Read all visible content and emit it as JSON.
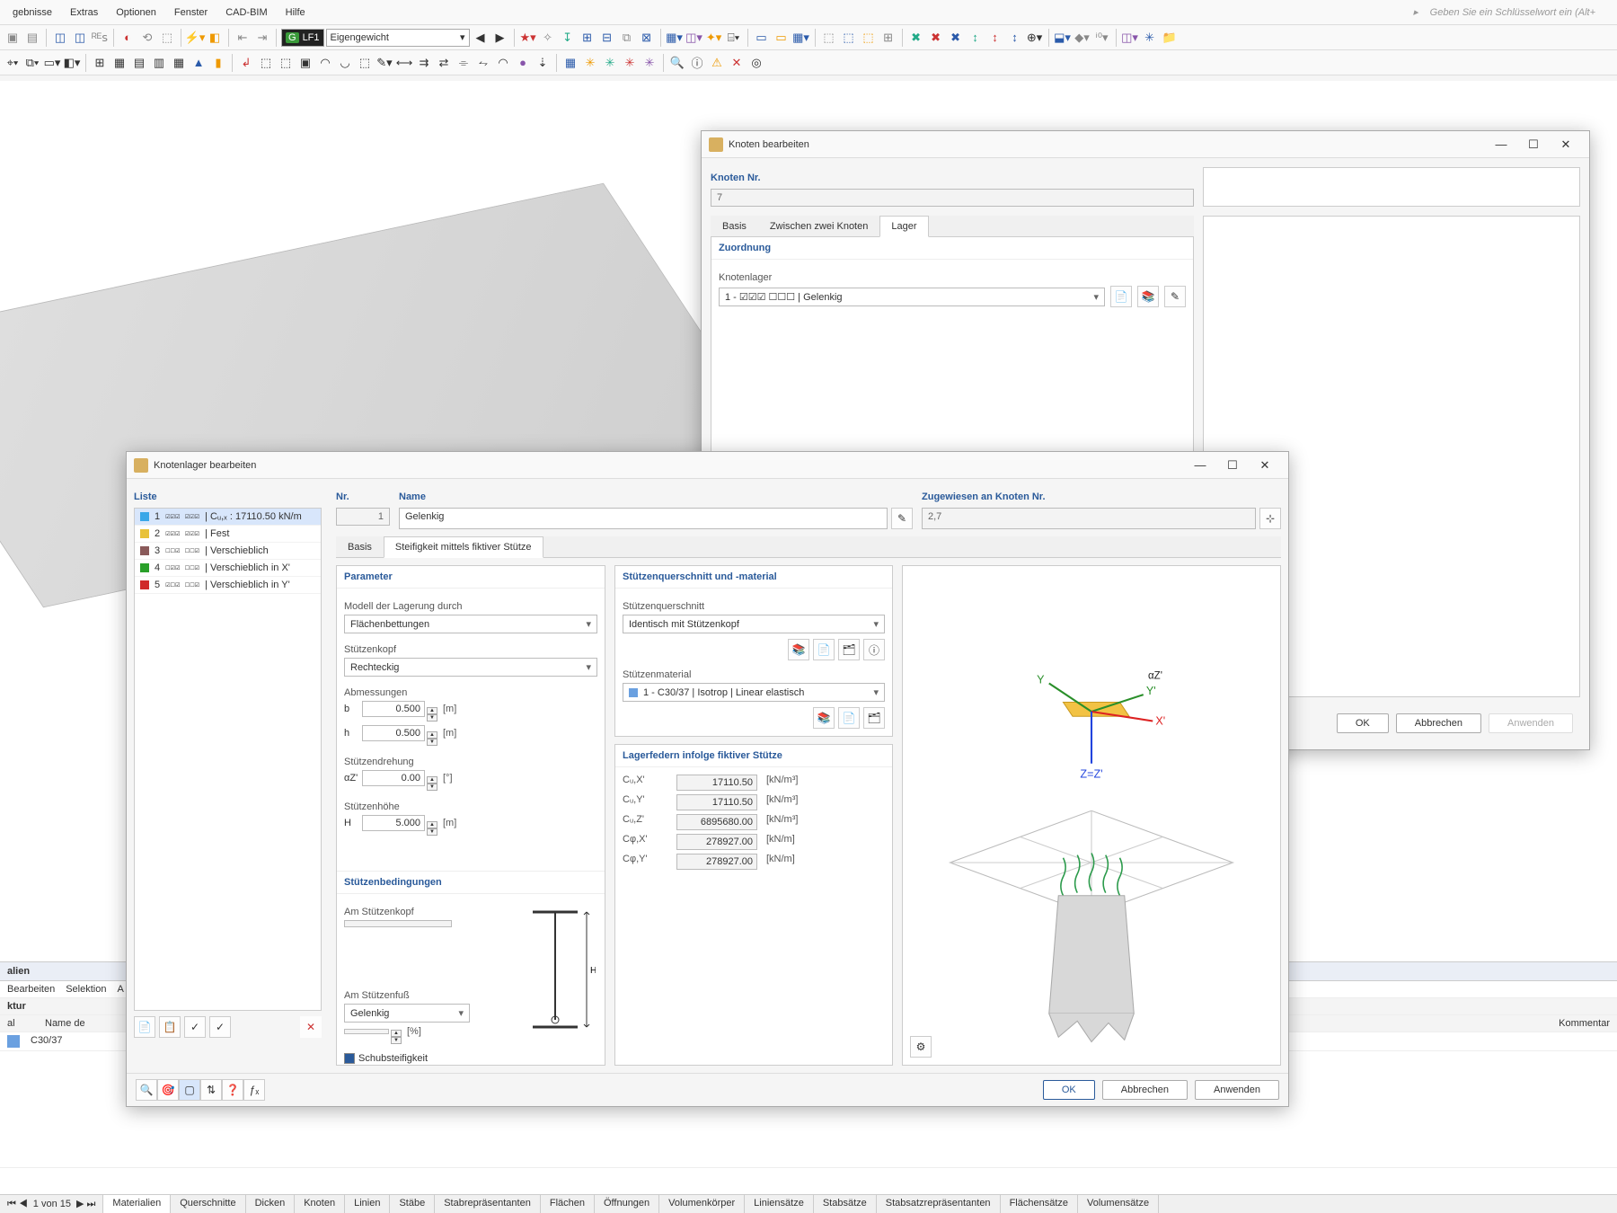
{
  "menu": {
    "items": [
      "gebnisse",
      "Extras",
      "Optionen",
      "Fenster",
      "CAD-BIM",
      "Hilfe"
    ],
    "search_hint": "Geben Sie ein Schlüsselwort ein (Alt+"
  },
  "tb1": {
    "lc_combo_code": "LF1",
    "lc_combo_label": "Eigengewicht",
    "g_badge": "G"
  },
  "dlg_node": {
    "title": "Knoten bearbeiten",
    "grp_nr": "Knoten Nr.",
    "nr_value": "7",
    "tabs": [
      "Basis",
      "Zwischen zwei Knoten",
      "Lager"
    ],
    "active_tab": 2,
    "assign_h": "Zuordnung",
    "assign_lbl": "Knotenlager",
    "assign_val": "1 - ☑☑☑ ☐☐☐ | Gelenkig",
    "ok": "OK",
    "cancel": "Abbrechen",
    "apply": "Anwenden"
  },
  "dlg_sup": {
    "title": "Knotenlager bearbeiten",
    "liste_h": "Liste",
    "list": [
      {
        "n": "1",
        "sym": "☑☑☑ ☑☑☑",
        "txt": "| Cᵤ,ₓ : 17110.50 kN/m",
        "clr": "#3aa7e8",
        "sel": true
      },
      {
        "n": "2",
        "sym": "☑☑☑ ☑☑☑",
        "txt": "| Fest",
        "clr": "#e8c23a"
      },
      {
        "n": "3",
        "sym": "☐☐☑ ☐☐☑",
        "txt": "| Verschieblich",
        "clr": "#8a5a5a"
      },
      {
        "n": "4",
        "sym": "☐☑☑ ☐☐☑",
        "txt": "| Verschieblich in X'",
        "clr": "#2aa02a"
      },
      {
        "n": "5",
        "sym": "☑☐☑ ☐☐☑",
        "txt": "| Verschieblich in Y'",
        "clr": "#d02a2a"
      }
    ],
    "nr_h": "Nr.",
    "nr_v": "1",
    "name_h": "Name",
    "name_v": "Gelenkig",
    "assigned_h": "Zugewiesen an Knoten Nr.",
    "assigned_v": "2,7",
    "tabs": [
      "Basis",
      "Steifigkeit mittels fiktiver Stütze"
    ],
    "active_tab": 1,
    "param_h": "Parameter",
    "model_lbl": "Modell der Lagerung durch",
    "model_v": "Flächenbettungen",
    "head_lbl": "Stützenkopf",
    "head_v": "Rechteckig",
    "dim_lbl": "Abmessungen",
    "b_lbl": "b",
    "b_v": "0.500",
    "b_u": "[m]",
    "h_lbl": "h",
    "h_v": "0.500",
    "h_u": "[m]",
    "rot_lbl": "Stützendrehung",
    "az_lbl": "αZ'",
    "az_v": "0.00",
    "az_u": "[°]",
    "height_lbl": "Stützenhöhe",
    "H_lbl": "H",
    "H_v": "5.000",
    "H_u": "[m]",
    "cond_h": "Stützenbedingungen",
    "top_lbl": "Am Stützenkopf",
    "bot_lbl": "Am Stützenfuß",
    "bot_v": "Gelenkig",
    "bot_pct_u": "[%]",
    "shear_lbl": "Schubsteifigkeit",
    "xs_h": "Stützenquerschnitt und -material",
    "xs_lbl": "Stützenquerschnitt",
    "xs_v": "Identisch mit Stützenkopf",
    "mat_lbl": "Stützenmaterial",
    "mat_v": "1 - C30/37 | Isotrop | Linear elastisch",
    "springs_h": "Lagerfedern infolge fiktiver Stütze",
    "springs": [
      {
        "l": "Cᵤ,X'",
        "v": "17110.50",
        "u": "[kN/m³]"
      },
      {
        "l": "Cᵤ,Y'",
        "v": "17110.50",
        "u": "[kN/m³]"
      },
      {
        "l": "Cᵤ,Z'",
        "v": "6895680.00",
        "u": "[kN/m³]"
      },
      {
        "l": "Cφ,X'",
        "v": "278927.00",
        "u": "[kN/m]"
      },
      {
        "l": "Cφ,Y'",
        "v": "278927.00",
        "u": "[kN/m]"
      }
    ],
    "ok": "OK",
    "cancel": "Abbrechen",
    "apply": "Anwenden"
  },
  "bottom": {
    "panel_h": "alien",
    "row_items": [
      "Bearbeiten",
      "Selektion",
      "A"
    ],
    "sub_h": "ktur",
    "col_a": "al",
    "col_name": "Name de",
    "col_comment": "Kommentar",
    "cell_mat": "C30/37",
    "nav": "1 von 15",
    "tabs": [
      "Materialien",
      "Querschnitte",
      "Dicken",
      "Knoten",
      "Linien",
      "Stäbe",
      "Stabrepräsentanten",
      "Flächen",
      "Öffnungen",
      "Volumenkörper",
      "Liniensätze",
      "Stabsätze",
      "Stabsatzrepräsentanten",
      "Flächensätze",
      "Volumensätze"
    ],
    "active_tab": 0
  }
}
